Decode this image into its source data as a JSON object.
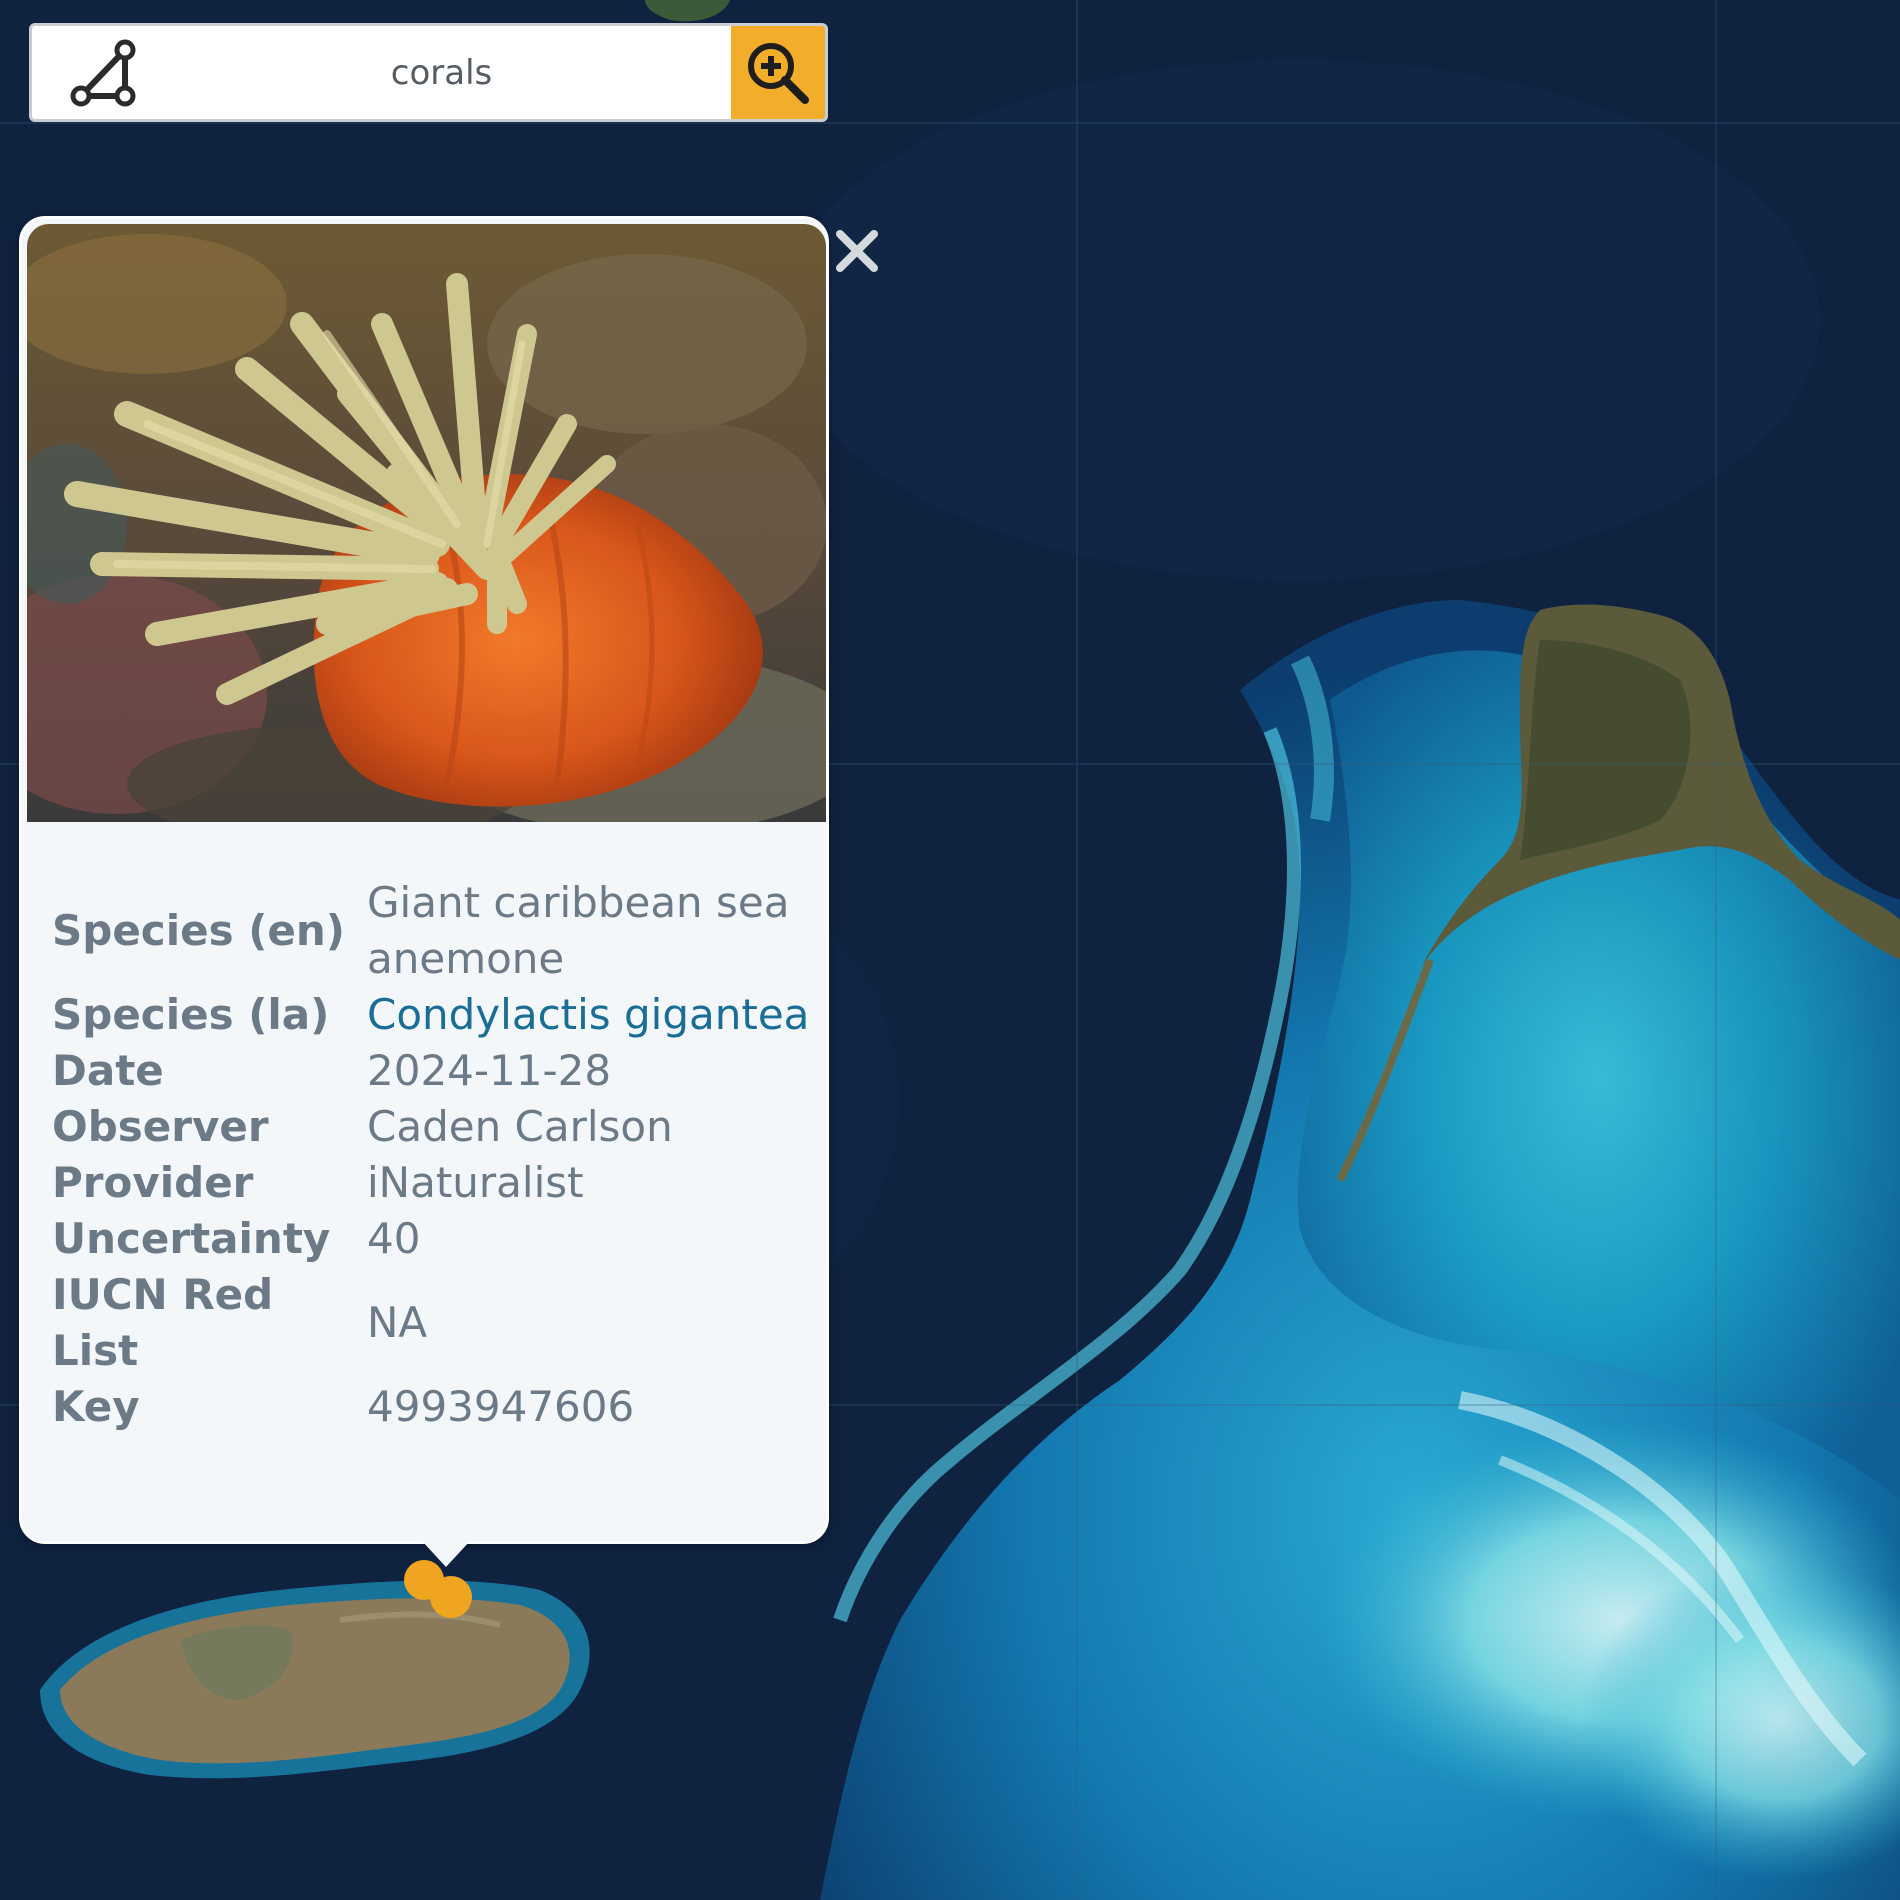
{
  "search": {
    "value": "corals",
    "draw_tool_icon": "polygon-draw-icon",
    "search_icon": "zoom-in-search-icon",
    "accent_color": "#f2ae2a"
  },
  "popup": {
    "photo_subject": "photo of sea anemone",
    "close_icon": "close-icon",
    "rows": [
      {
        "label": "Species (en)",
        "value": "Giant caribbean sea anemone"
      },
      {
        "label": "Species (la)",
        "value": "Condylactis gigantea"
      },
      {
        "label": "Date",
        "value": "2024-11-28"
      },
      {
        "label": "Observer",
        "value": "Caden Carlson"
      },
      {
        "label": "Provider",
        "value": "iNaturalist"
      },
      {
        "label": "Uncertainty",
        "value": "40"
      },
      {
        "label": "IUCN Red List",
        "value": "NA"
      },
      {
        "label": "Key",
        "value": "4993947606"
      }
    ],
    "link_color": "#1a6d94"
  },
  "map": {
    "basemap": "satellite",
    "markers": 2,
    "marker_color": "#f0a520"
  }
}
